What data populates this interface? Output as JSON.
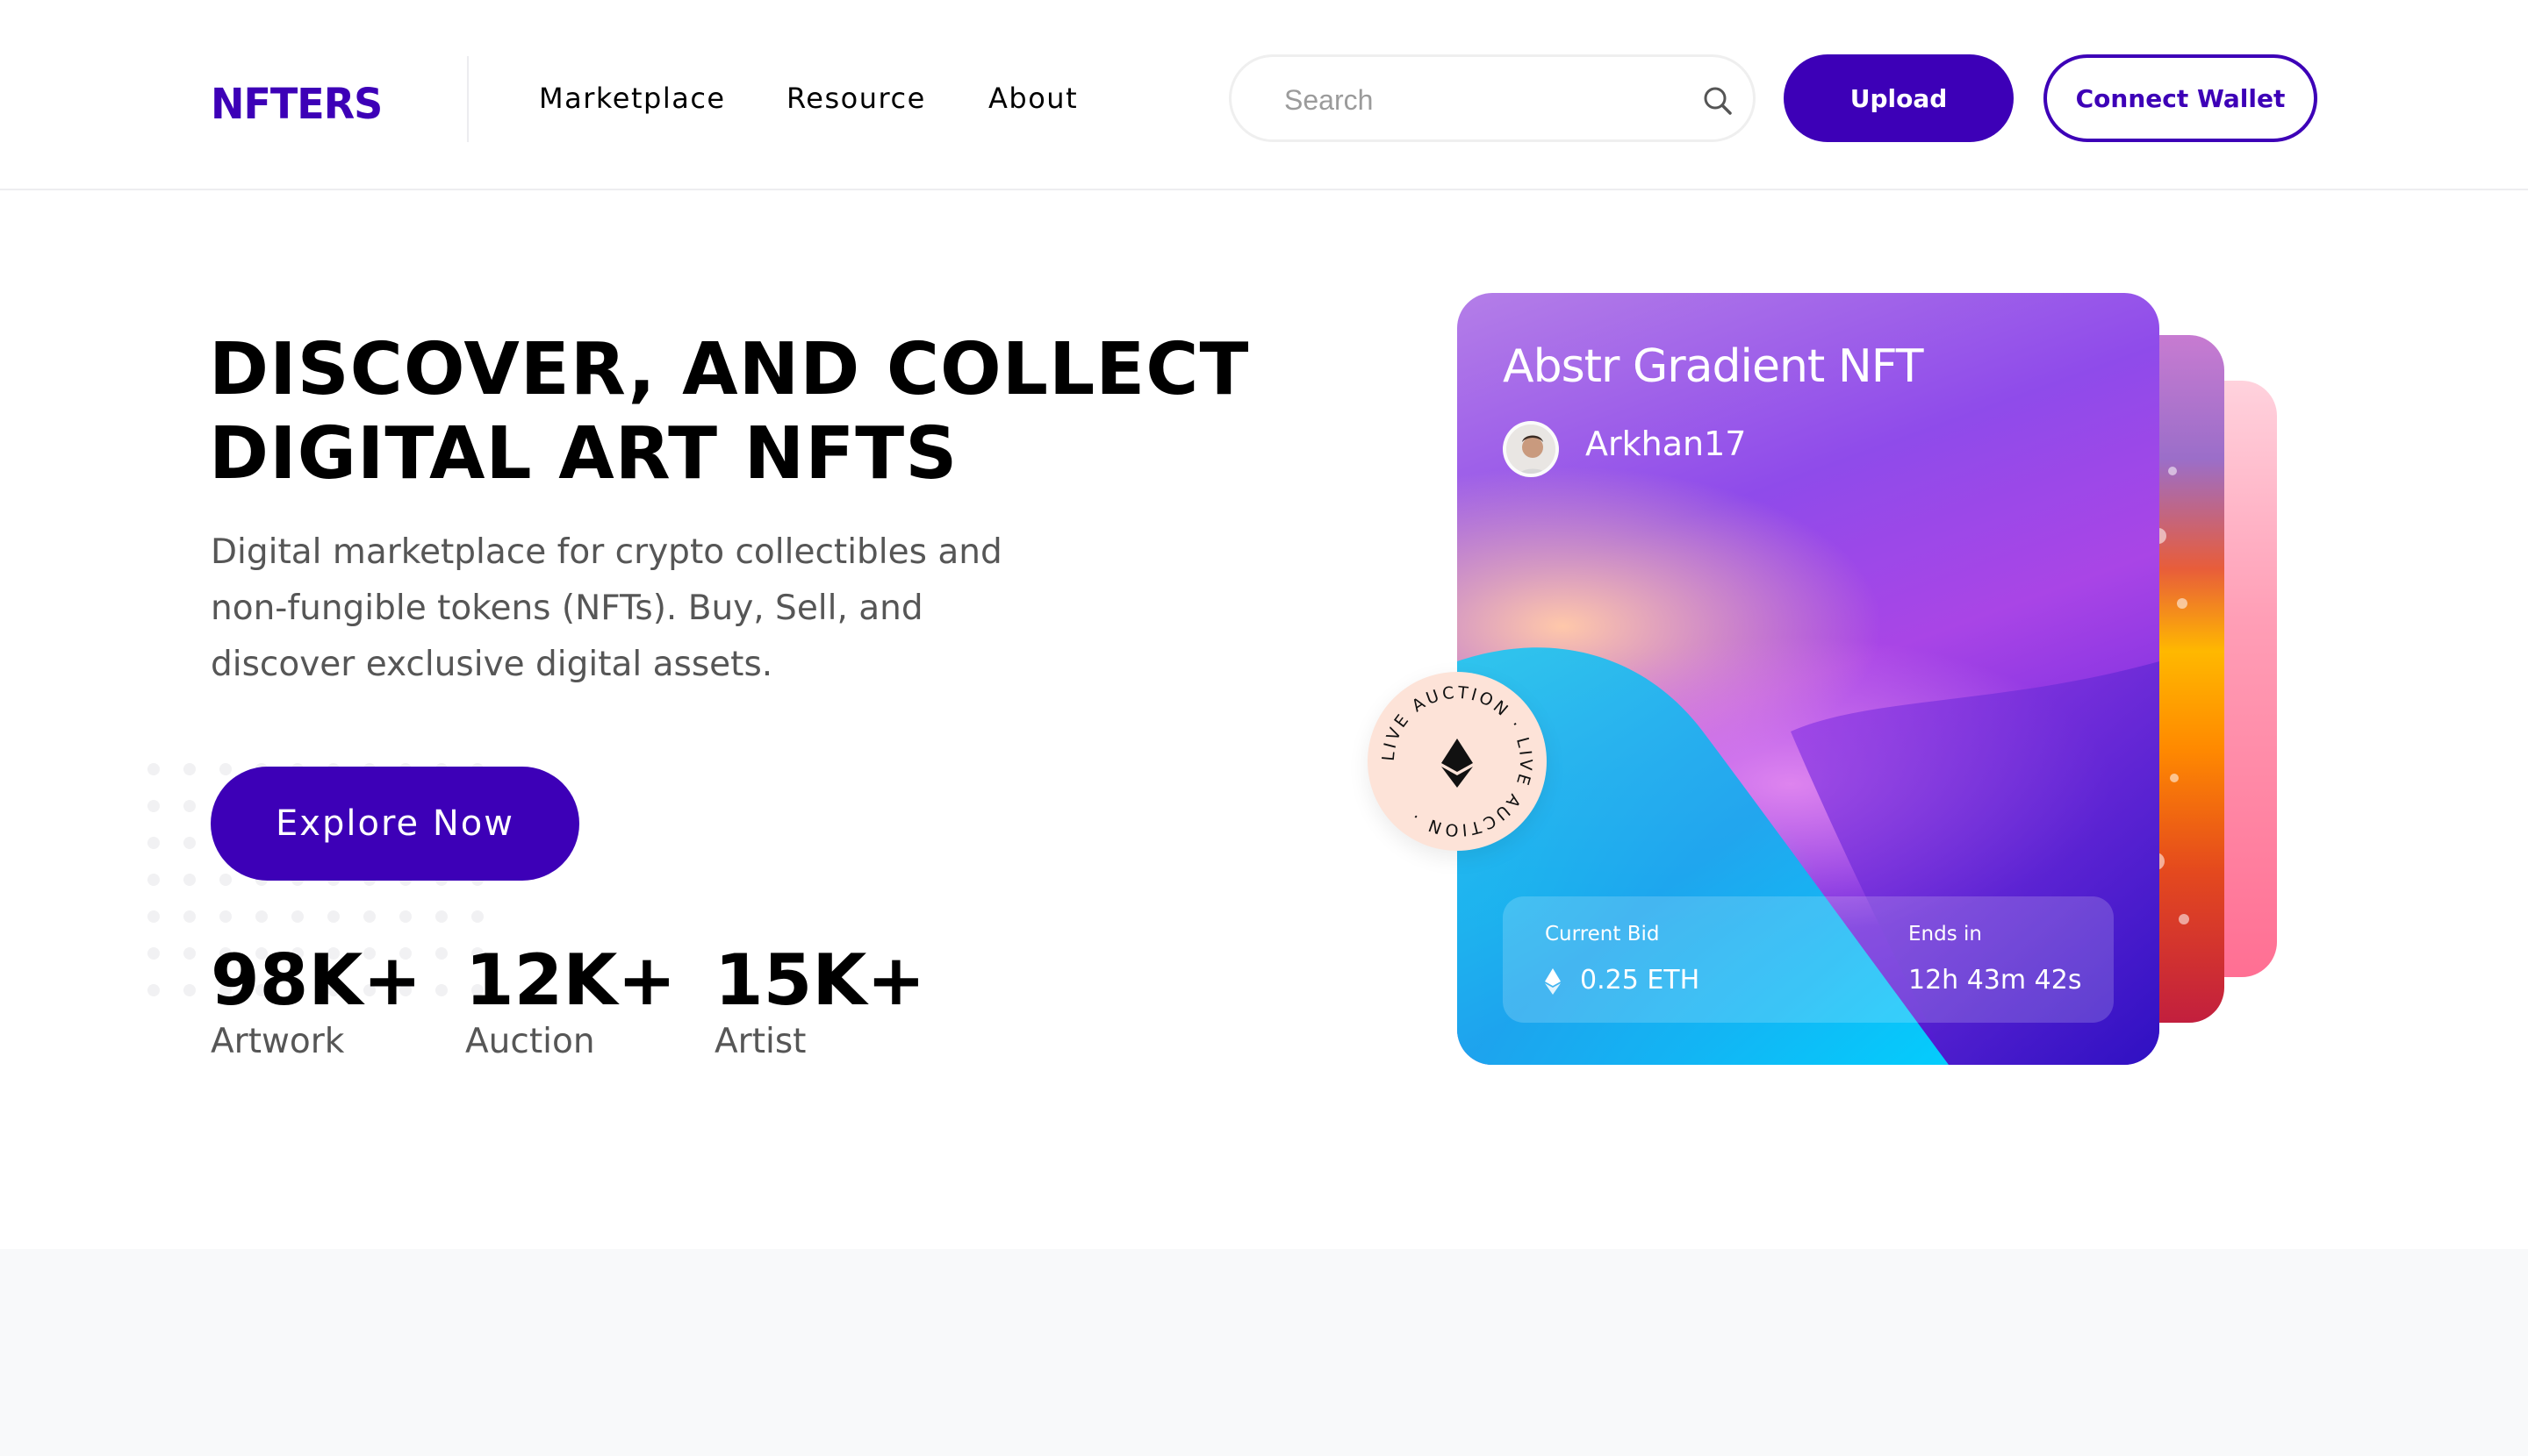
{
  "header": {
    "logo": "NFTERS",
    "nav": [
      "Marketplace",
      "Resource",
      "About"
    ],
    "search_placeholder": "Search",
    "upload_label": "Upload",
    "wallet_label": "Connect Wallet"
  },
  "hero": {
    "title_lines": [
      "DISCOVER, AND COLLECT",
      "DIGITAL ART NFTS"
    ],
    "subtitle_lines": [
      "Digital marketplace for crypto collectibles and",
      "non-fungible tokens (NFTs). Buy, Sell, and",
      "discover exclusive digital assets."
    ],
    "cta_label": "Explore Now",
    "stats": [
      {
        "value": "98K+",
        "label": "Artwork"
      },
      {
        "value": "12K+",
        "label": "Auction"
      },
      {
        "value": "15K+",
        "label": "Artist"
      }
    ]
  },
  "card": {
    "title": "Abstr Gradient NFT",
    "author": "Arkhan17",
    "bid_label": "Current Bid",
    "bid_value": "0.25 ETH",
    "ends_label": "Ends in",
    "ends_value": "12h 43m 42s",
    "badge_text": "LIVE AUCTION · LIVE AUCTION ·"
  },
  "colors": {
    "brand": "#3d00b7",
    "text_muted": "#565656",
    "badge_bg": "#fde3d8"
  },
  "icons": {
    "search": "search-icon",
    "eth": "ethereum-icon"
  }
}
